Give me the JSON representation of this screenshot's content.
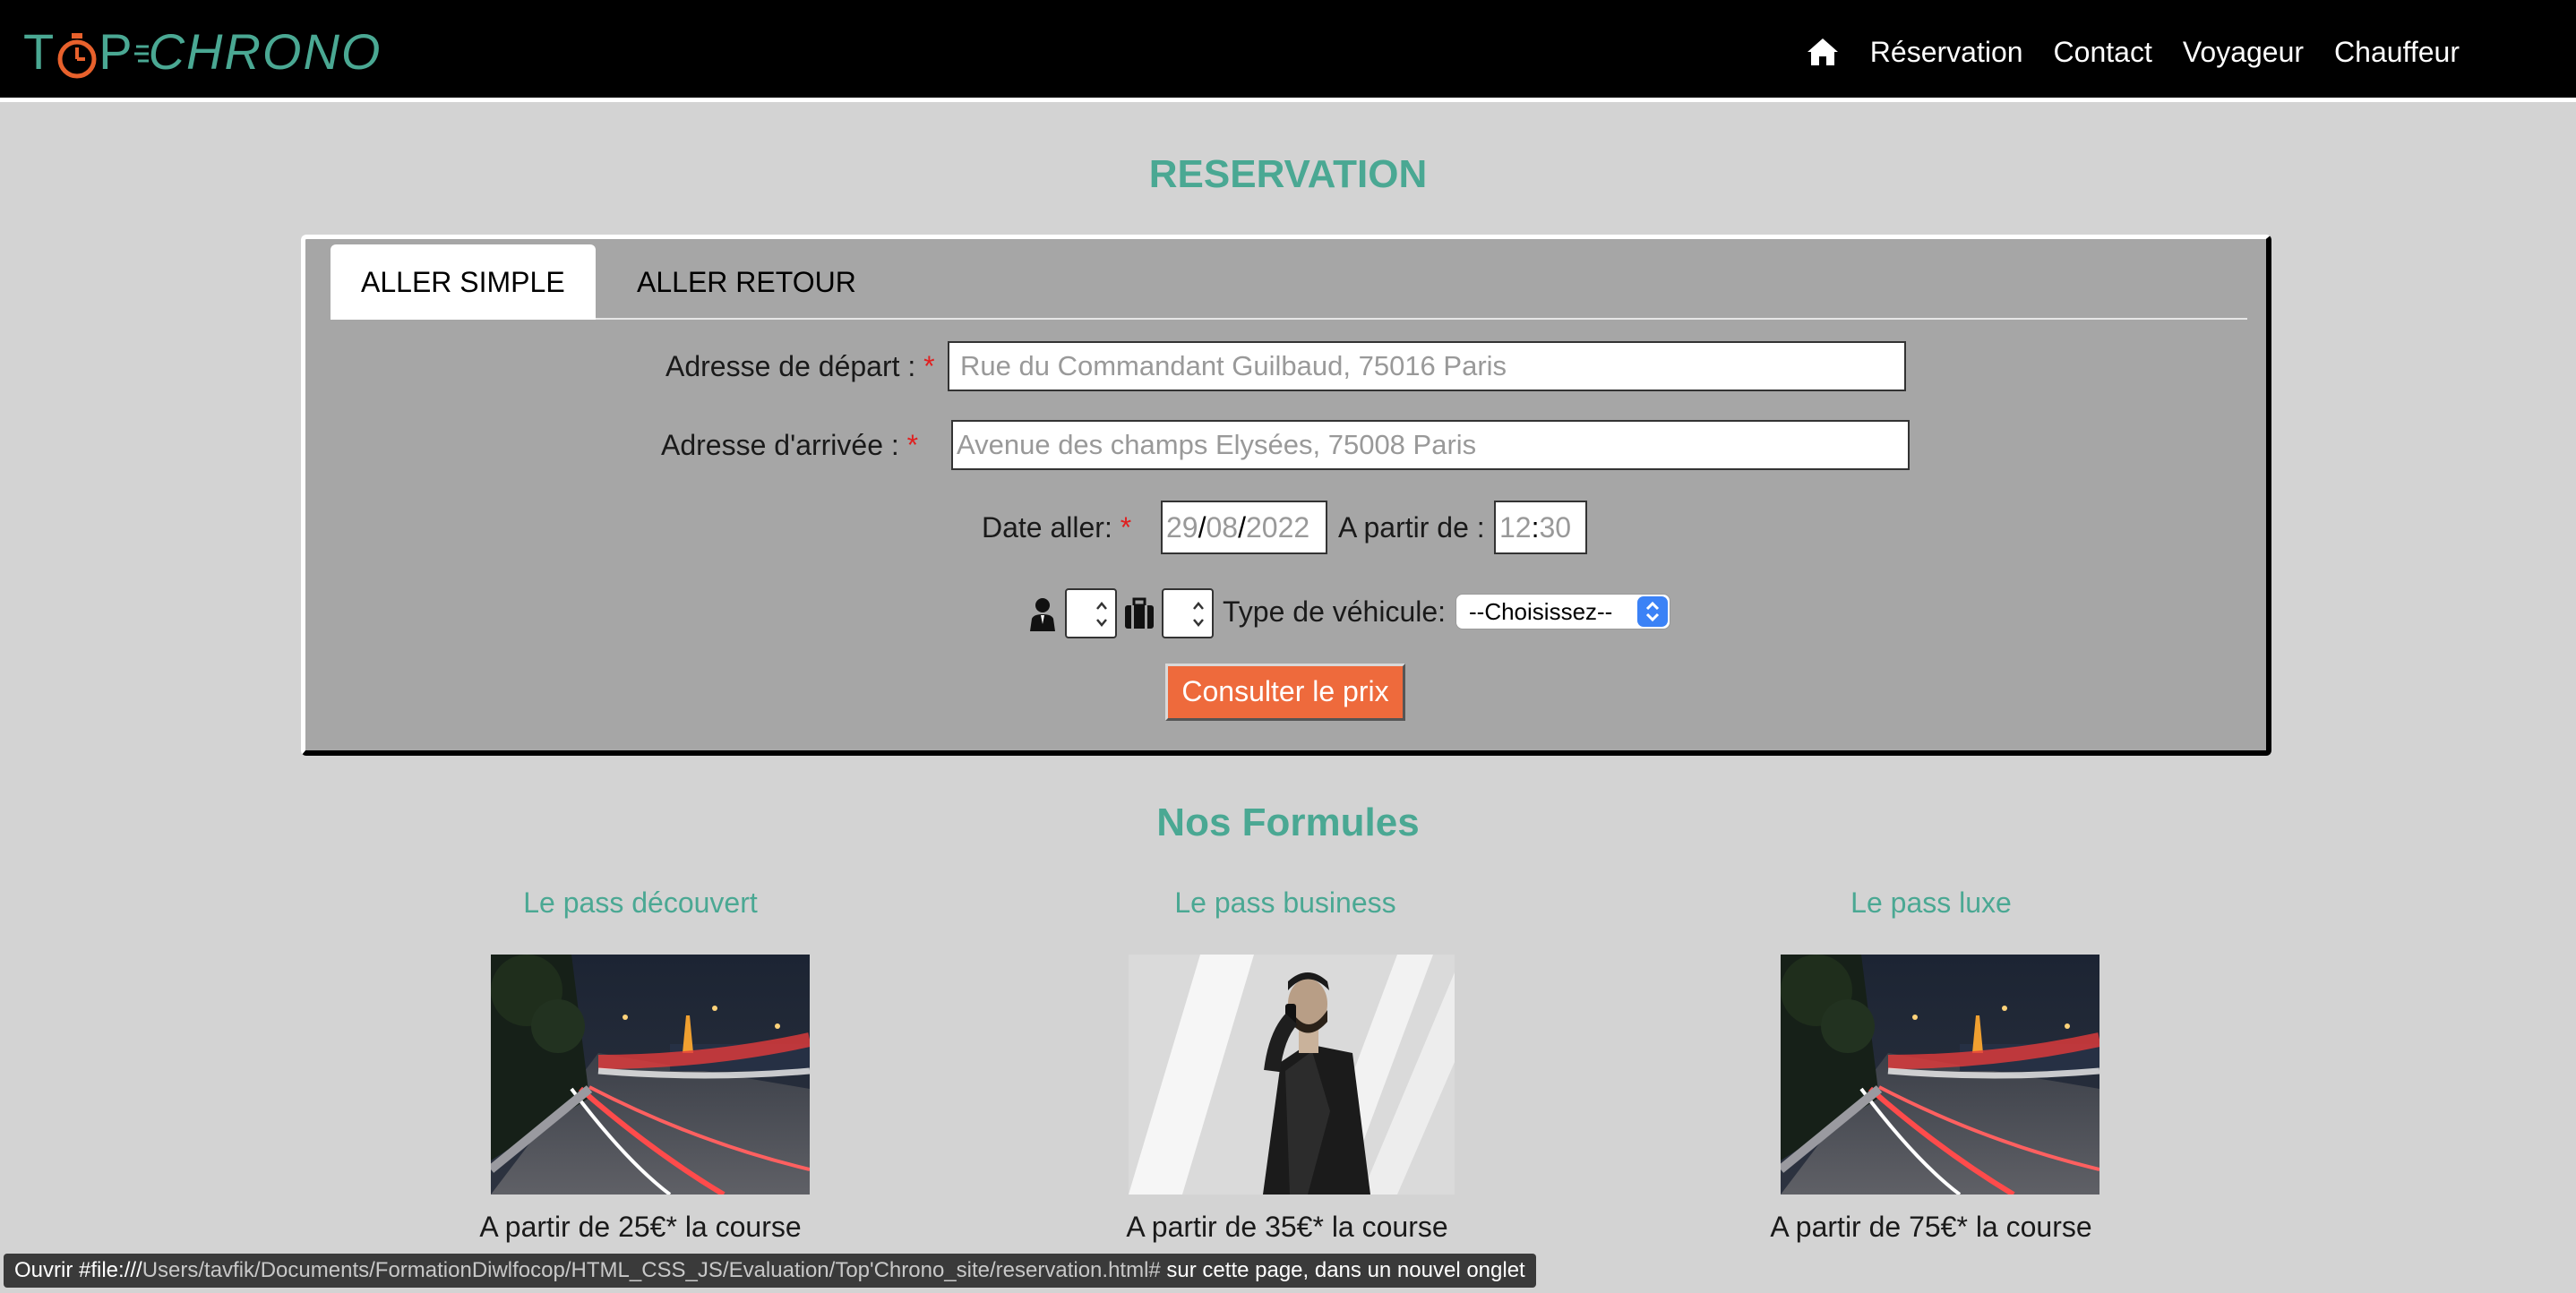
{
  "brand": {
    "logo_top": "T",
    "logo_p": "P",
    "logo_chrono": "CHRONO",
    "accent": "#4aa893"
  },
  "nav": {
    "items": [
      "Réservation",
      "Contact",
      "Voyageur",
      "Chauffeur"
    ],
    "home_icon": "home-icon"
  },
  "page_title": "RESERVATION",
  "form": {
    "tabs": [
      "ALLER SIMPLE",
      "ALLER RETOUR"
    ],
    "depart_label": "Adresse de départ :",
    "depart_placeholder": "Rue du Commandant Guilbaud, 75016 Paris",
    "arrivee_label": "Adresse d'arrivée :",
    "arrivee_placeholder": "Avenue des champs Elysées, 75008 Paris",
    "required_mark": "*",
    "date_label": "Date aller:",
    "date_day": "29",
    "date_month": "08",
    "date_year": "2022",
    "date_sep": "/",
    "time_label": "A partir de :",
    "time_hour": "12",
    "time_sep": ":",
    "time_min": "30",
    "vehicle_label": "Type de véhicule:",
    "vehicle_selected": "--Choisissez--",
    "submit": "Consulter le prix",
    "submit_color": "#ee6a3c"
  },
  "formules": {
    "title": "Nos Formules",
    "passes": [
      {
        "name": "Le pass découvert",
        "price": "A partir de 25€* la course"
      },
      {
        "name": "Le pass business",
        "price": "A partir de 35€* la course"
      },
      {
        "name": "Le pass luxe",
        "price": "A partir de 75€* la course"
      }
    ]
  },
  "status_bar": {
    "prefix": "Ouvrir #file:///",
    "path": "Users/tavfik/Documents/FormationDiwlfocop/HTML_CSS_JS/Evaluation/Top'Chrono_site/reservation.html#",
    "suffix": " sur cette page, dans un nouvel onglet"
  }
}
